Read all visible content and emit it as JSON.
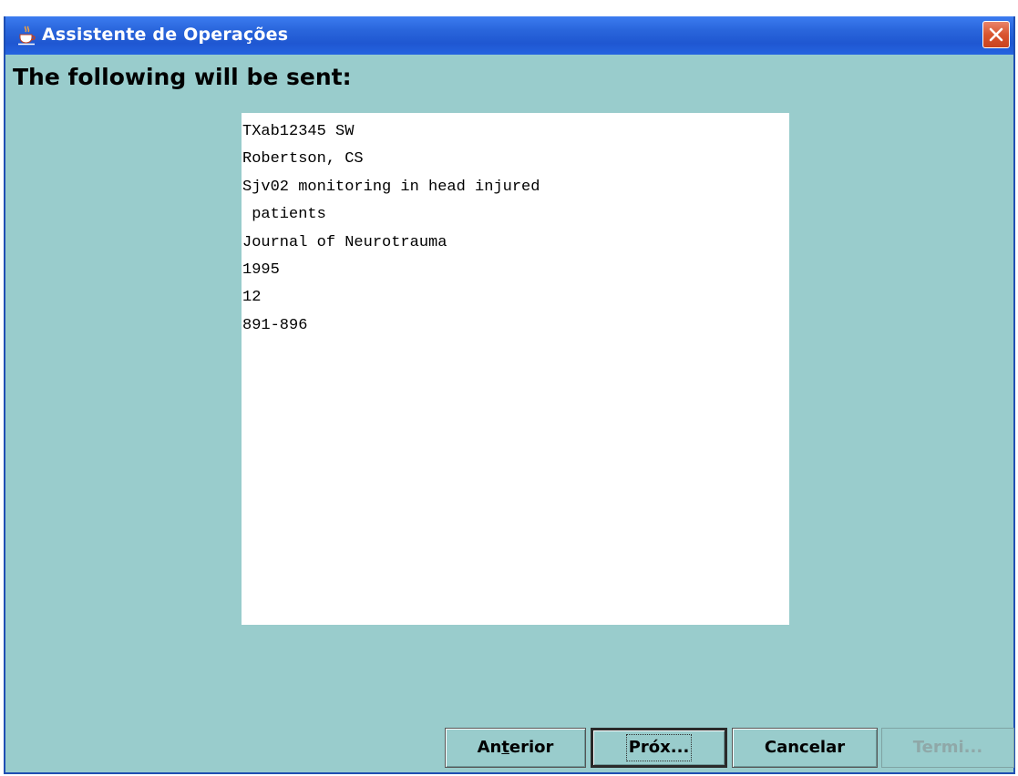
{
  "window": {
    "title": "Assistente de Operações",
    "app_icon": "java-coffee-cup-icon",
    "close_icon": "close-icon",
    "accent_color": "#2563e0",
    "background_color": "#99cccc",
    "close_color": "#d9552f"
  },
  "main": {
    "heading": "The following will be sent:",
    "text_lines": [
      "TXab12345 SW",
      "Robertson, CS",
      "Sjv02 monitoring in head injured",
      " patients",
      "Journal of Neurotrauma",
      "1995",
      "12",
      "891-896"
    ]
  },
  "buttons": {
    "back": {
      "pre": "An",
      "mnemonic": "t",
      "post": "erior",
      "enabled": true
    },
    "next": {
      "label": "Próx...",
      "enabled": true,
      "focused": true
    },
    "cancel": {
      "label": "Cancelar",
      "enabled": true
    },
    "finish": {
      "label": "Termi...",
      "enabled": false
    }
  }
}
